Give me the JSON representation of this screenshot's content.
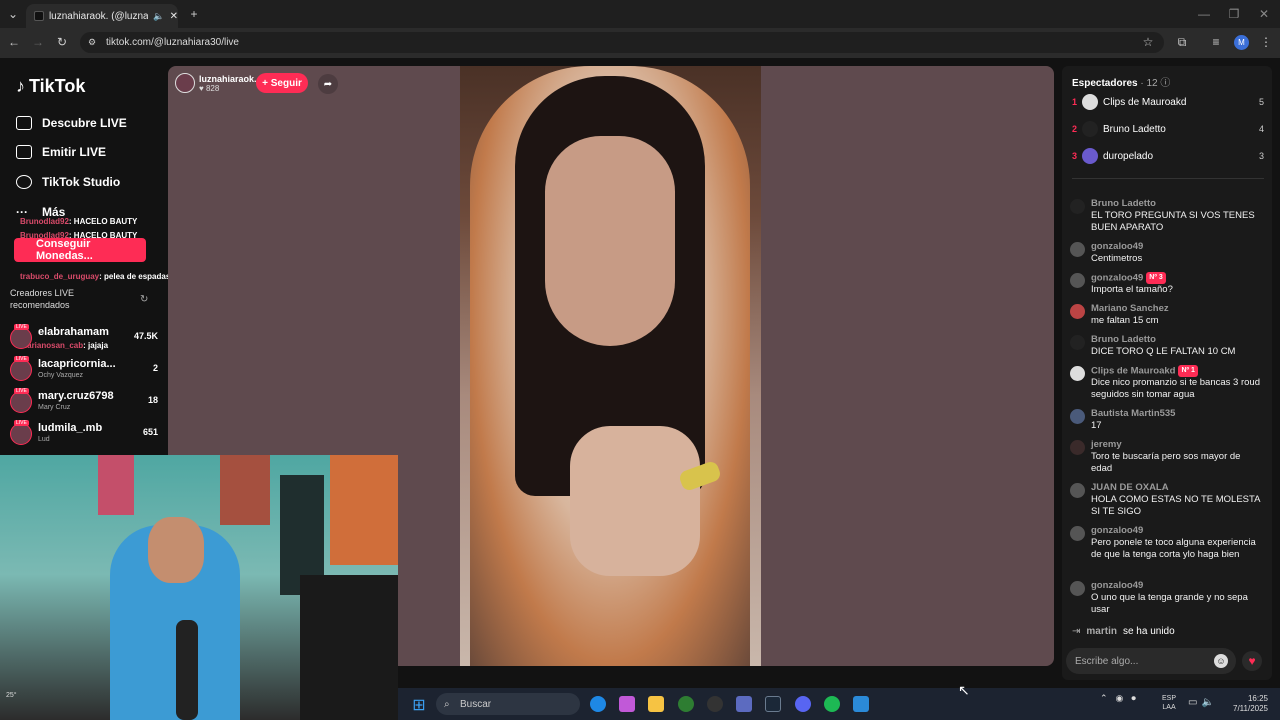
{
  "browser": {
    "tab_title": "luznahiaraok. (@luznahiara...",
    "url": "tiktok.com/@luznahiara30/live",
    "profile_initial": "M"
  },
  "nav": {
    "logo": "TikTok",
    "items": [
      {
        "label": "Descubre LIVE"
      },
      {
        "label": "Emitir LIVE"
      },
      {
        "label": "TikTok Studio"
      },
      {
        "label": "Más"
      }
    ],
    "login_button": "Conseguir Monedas..."
  },
  "overlay_chat": [
    {
      "user": "Brunodlad92",
      "text": ": HACELO BAUTY"
    },
    {
      "user": "Brunodlad92",
      "text": ": HACELO BAUTY"
    },
    {
      "user": "trabuco_de_uruguay",
      "text": ": pelea de espadas con el bauty"
    },
    {
      "user": "marianosan_cab",
      "text": ": jajaja"
    }
  ],
  "recommended": {
    "header": "Creadores LIVE recomendados",
    "items": [
      {
        "name": "elabrahamam",
        "sub": "",
        "count": "47.5K"
      },
      {
        "name": "lacapricornia...",
        "sub": "Ochy Vazquez",
        "count": "2"
      },
      {
        "name": "mary.cruz6798",
        "sub": "Mary Cruz",
        "count": "18"
      },
      {
        "name": "ludmila_.mb",
        "sub": "Lud",
        "count": "651"
      }
    ]
  },
  "stream": {
    "streamer_name": "luznahiaraok.",
    "likes": "828",
    "follow_label": "+ Seguir"
  },
  "viewers": {
    "title": "Espectadores",
    "count": "12",
    "top": [
      {
        "rank": "1",
        "name": "Clips de Mauroakd",
        "score": "5"
      },
      {
        "rank": "2",
        "name": "Bruno Ladetto",
        "score": "4"
      },
      {
        "rank": "3",
        "name": "duropelado",
        "score": "3"
      }
    ]
  },
  "chat": [
    {
      "user": "Bruno Ladetto",
      "badge": "",
      "text": "EL TORO PREGUNTA SI VOS TENES BUEN APARATO"
    },
    {
      "user": "gonzaloo49",
      "badge": "",
      "text": "Centimetros"
    },
    {
      "user": "gonzaloo49",
      "badge": "Nº 3",
      "text": "Importa el tamaño?"
    },
    {
      "user": "Mariano Sanchez",
      "badge": "",
      "text": "me faltan 15 cm"
    },
    {
      "user": "Bruno Ladetto",
      "badge": "",
      "text": "DICE TORO Q LE FALTAN 10 CM"
    },
    {
      "user": "Clips de Mauroakd",
      "badge": "Nº 1",
      "text": "Dice nico promanzio si te bancas 3 roud seguidos sin tomar agua"
    },
    {
      "user": "Bautista Martin535",
      "badge": "",
      "text": "17"
    },
    {
      "user": "jeremy",
      "badge": "",
      "text": "Toro te buscaría pero sos mayor de edad"
    },
    {
      "user": "JUAN DE OXALA",
      "badge": "",
      "text": "HOLA COMO ESTAS NO TE MOLESTA SI TE SIGO"
    },
    {
      "user": "gonzaloo49",
      "badge": "",
      "text": "Pero ponele te toco alguna experiencia de que la tenga corta ylo haga bien"
    },
    {
      "user": "gonzaloo49",
      "badge": "",
      "text": "O uno que la tenga grande y no sepa usar"
    }
  ],
  "join": {
    "user": "martin",
    "text": "se ha unido"
  },
  "chat_input_placeholder": "Escribe algo...",
  "taskbar": {
    "search_placeholder": "Buscar",
    "lang_line1": "ESP",
    "lang_line2": "LAA",
    "time": "16:25",
    "date": "7/11/2025",
    "weather": "25°"
  }
}
